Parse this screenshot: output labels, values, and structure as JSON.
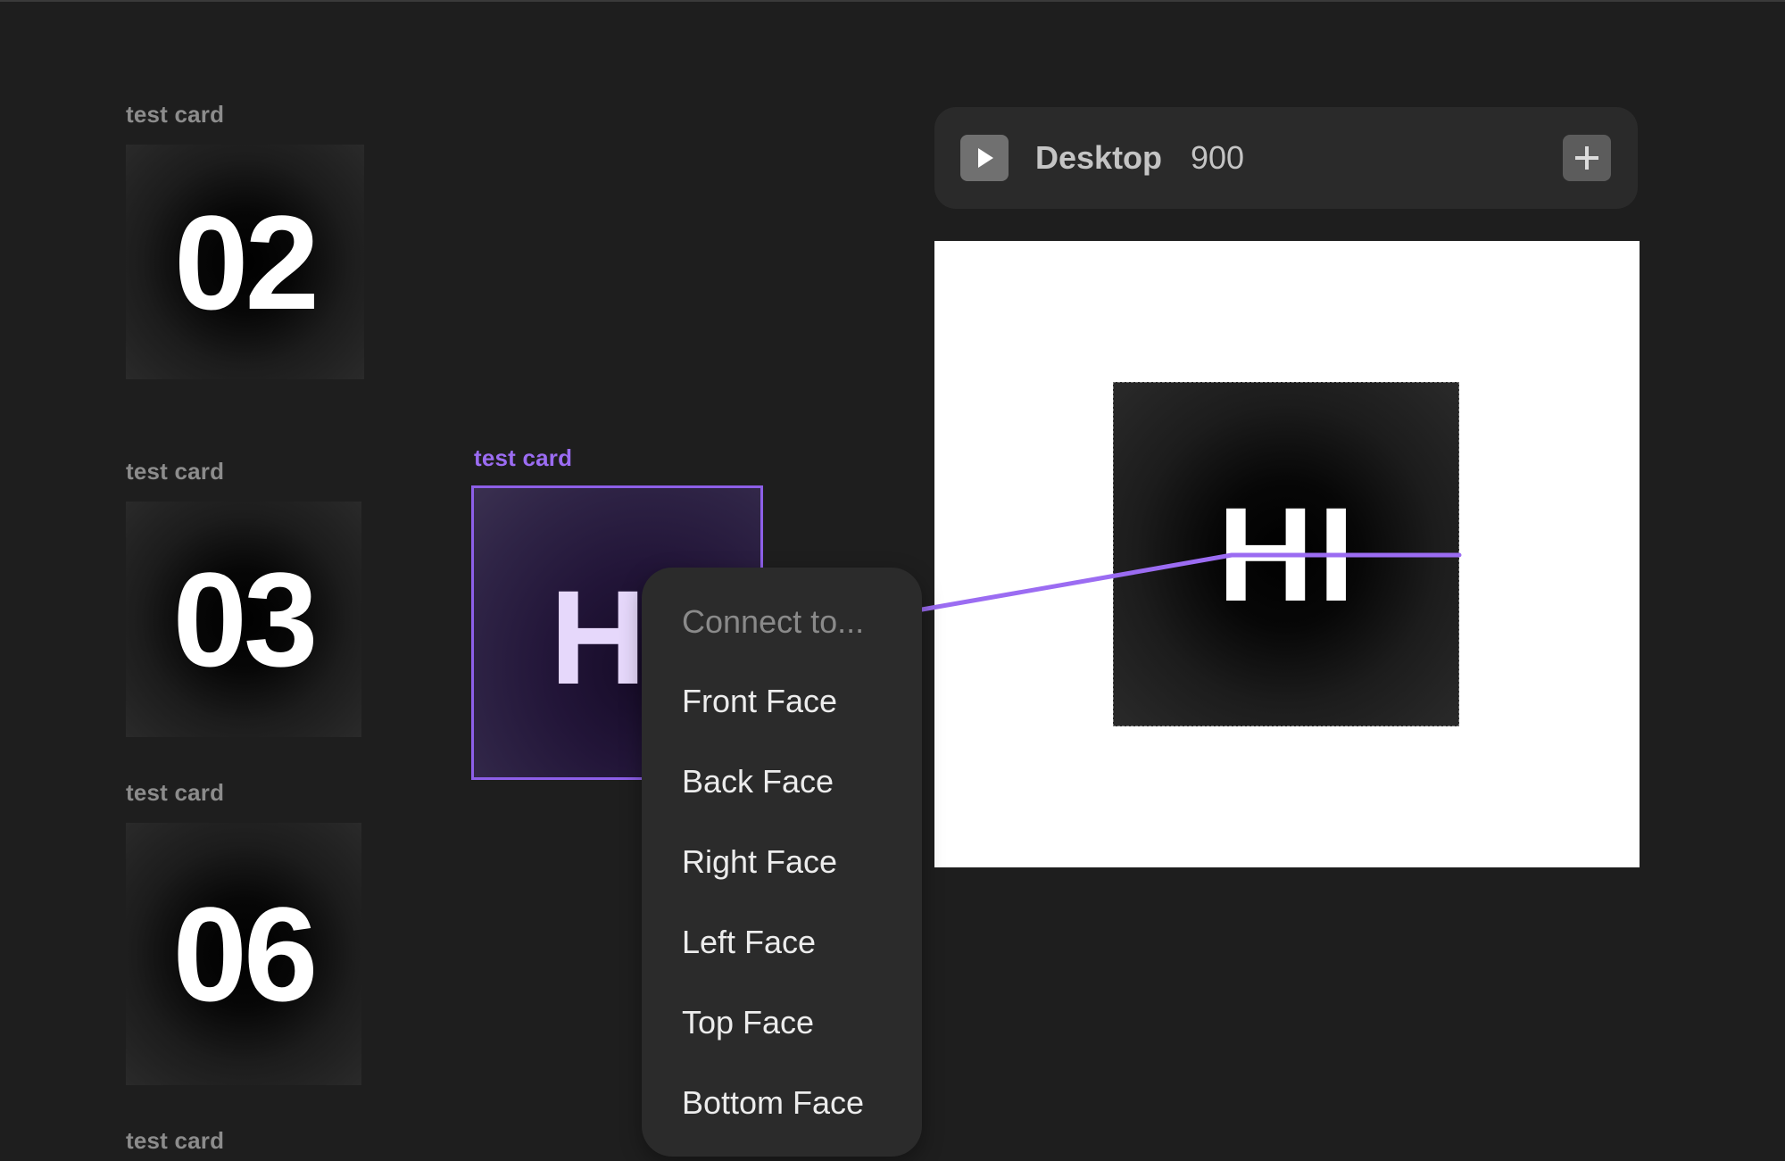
{
  "canvas": {
    "frames": [
      {
        "label": "test card",
        "number": "02"
      },
      {
        "label": "test card",
        "number": "03"
      },
      {
        "label": "test card",
        "number": "06"
      },
      {
        "label": "test card"
      }
    ],
    "selected_frame": {
      "label": "test card",
      "number": "H"
    }
  },
  "preview": {
    "title": "Desktop",
    "width": "900",
    "card_text": "HI"
  },
  "menu": {
    "header": "Connect to...",
    "items": [
      "Front Face",
      "Back Face",
      "Right Face",
      "Left Face",
      "Top Face",
      "Bottom Face"
    ]
  },
  "colors": {
    "accent": "#9b6cf2",
    "canvas_bg": "#1e1e1e",
    "menu_bg": "#2b2b2b",
    "preview_bg": "#ffffff"
  },
  "icons": {
    "play": "play-icon",
    "add": "plus-icon"
  }
}
